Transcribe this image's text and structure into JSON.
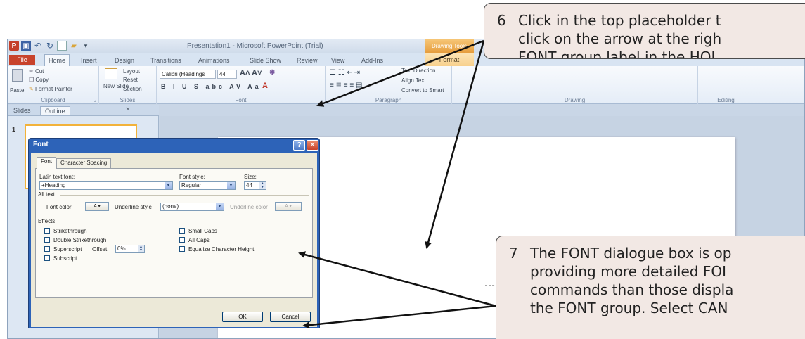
{
  "app": {
    "window_title": "Presentation1 - Microsoft PowerPoint (Trial)",
    "contextual_tab_group": "Drawing Tools"
  },
  "tabs": [
    {
      "label": "File"
    },
    {
      "label": "Home"
    },
    {
      "label": "Insert"
    },
    {
      "label": "Design"
    },
    {
      "label": "Transitions"
    },
    {
      "label": "Animations"
    },
    {
      "label": "Slide Show"
    },
    {
      "label": "Review"
    },
    {
      "label": "View"
    },
    {
      "label": "Add-Ins"
    },
    {
      "label": "Format"
    }
  ],
  "ribbon": {
    "clipboard": {
      "label": "Clipboard",
      "paste": "Paste",
      "cut": "Cut",
      "copy": "Copy",
      "format_painter": "Format Painter"
    },
    "slides": {
      "label": "Slides",
      "new_slide": "New Slide",
      "layout": "Layout",
      "reset": "Reset",
      "section": "Section"
    },
    "font": {
      "label": "Font",
      "font_name": "Calibri (Headings",
      "font_size": "44"
    },
    "paragraph": {
      "label": "Paragraph",
      "text_direction": "Text Direction",
      "align_text": "Align Text",
      "convert": "Convert to Smart"
    },
    "drawing": {
      "label": "Drawing"
    },
    "editing": {
      "label": "Editing"
    }
  },
  "panel": {
    "tabs": [
      "Slides",
      "Outline"
    ],
    "close": "×",
    "slide_number": "1"
  },
  "dialog": {
    "title": "Font",
    "help": "?",
    "close": "✕",
    "tabs": [
      "Font",
      "Character Spacing"
    ],
    "latin_text_font_label": "Latin text font:",
    "latin_text_font_value": "+Heading",
    "font_style_label": "Font style:",
    "font_style_value": "Regular",
    "size_label": "Size:",
    "size_value": "44",
    "all_text_label": "All text",
    "font_color_label": "Font color",
    "underline_style_label": "Underline style",
    "underline_style_value": "(none)",
    "underline_color_label": "Underline color",
    "effects_label": "Effects",
    "effects_left": [
      "Strikethrough",
      "Double Strikethrough",
      "Superscript",
      "Subscript"
    ],
    "offset_label": "Offset:",
    "offset_value": "0%",
    "effects_right": [
      "Small Caps",
      "All Caps",
      "Equalize Character Height"
    ],
    "ok": "OK",
    "cancel": "Cancel"
  },
  "callouts": {
    "step6": {
      "number": "6",
      "lines": [
        "Click in the top placeholder t",
        "click on the arrow at the righ",
        "FONT group label in the HOI"
      ]
    },
    "step7": {
      "number": "7",
      "lines": [
        "The FONT dialogue box is op",
        "providing more detailed FOI",
        "commands than those displa",
        "the FONT group. Select CAN"
      ]
    }
  }
}
